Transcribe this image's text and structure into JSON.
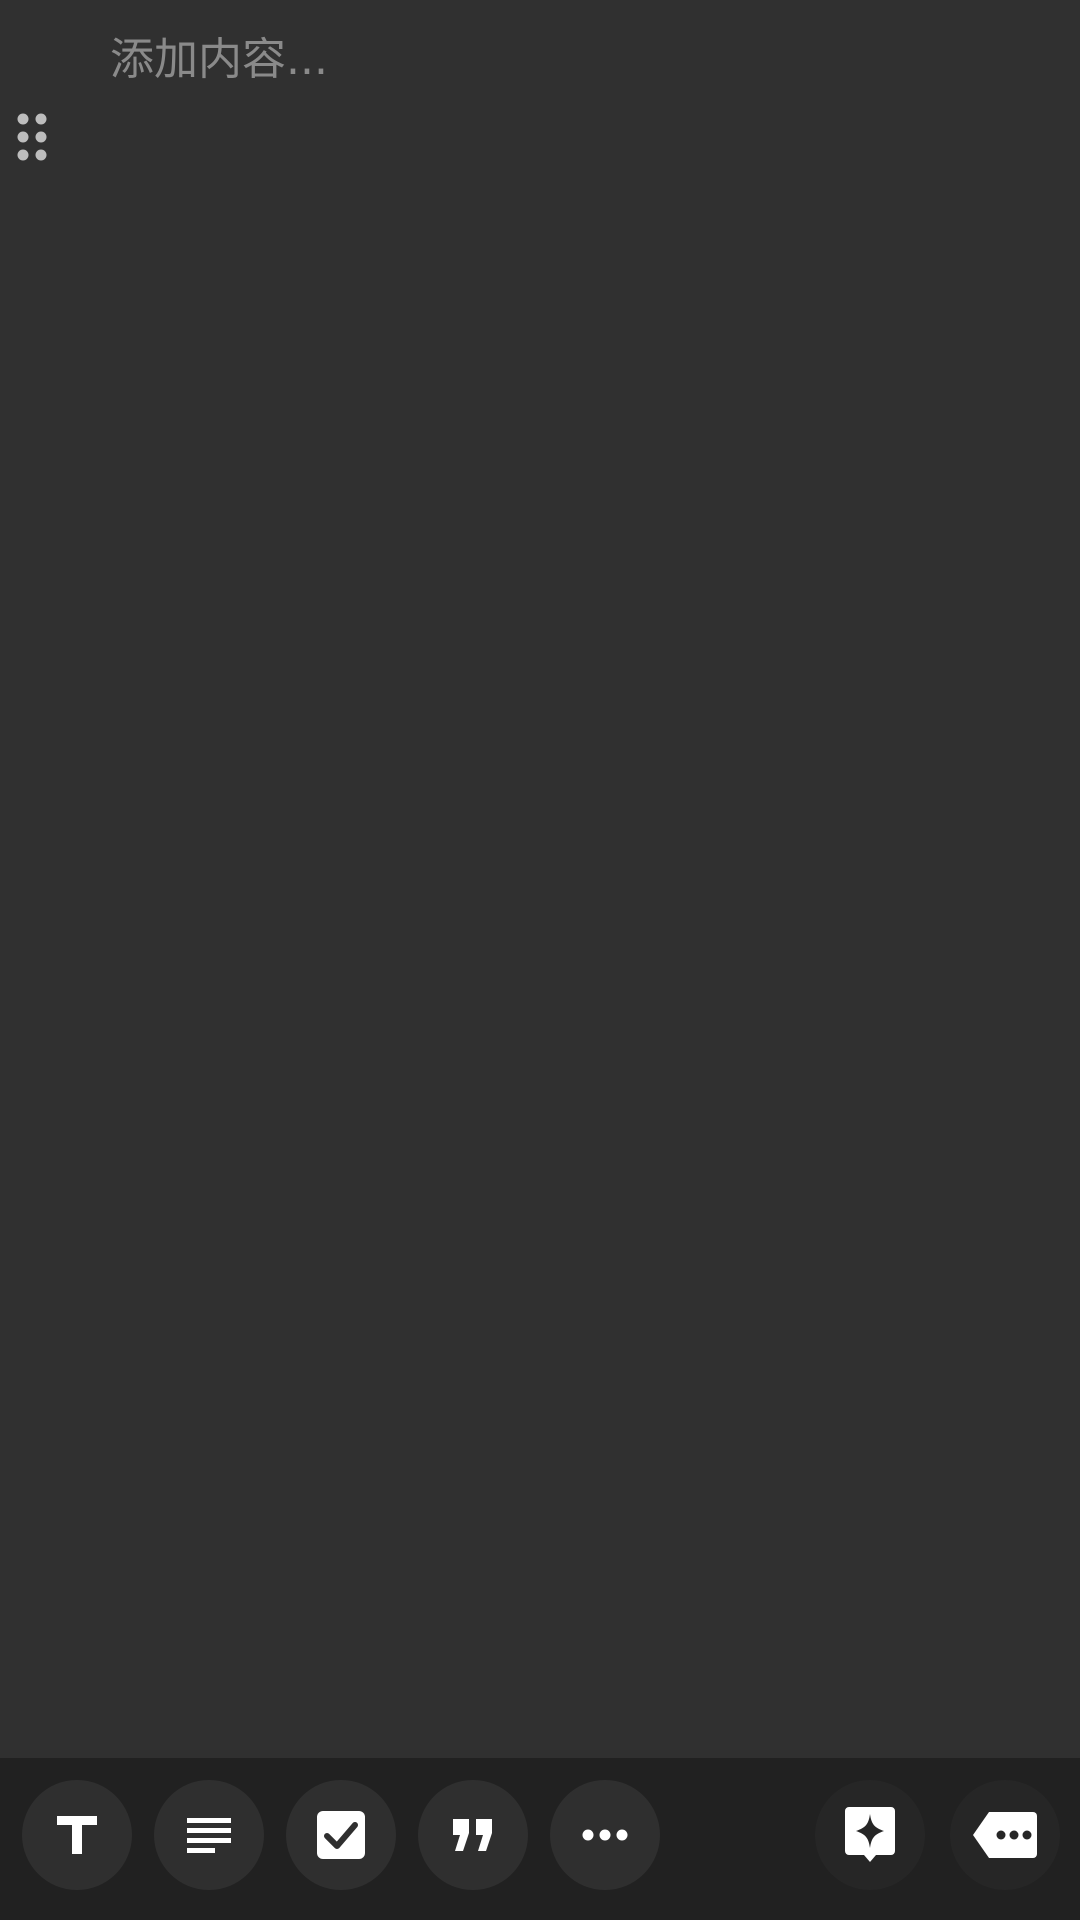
{
  "editor": {
    "placeholder": "添加内容..."
  },
  "toolbar": {
    "buttons": [
      {
        "icon": "title-t-icon",
        "action": "title"
      },
      {
        "icon": "paragraph-lines-icon",
        "action": "paragraph"
      },
      {
        "icon": "checkbox-icon",
        "action": "checklist"
      },
      {
        "icon": "quote-icon",
        "action": "quote"
      },
      {
        "icon": "more-dots-icon",
        "action": "more"
      },
      {
        "icon": "ai-sparkle-icon",
        "action": "ai-assist"
      },
      {
        "icon": "keyboard-hide-icon",
        "action": "hide-keyboard"
      }
    ]
  },
  "colors": {
    "background": "#303030",
    "toolbar": "#212121",
    "button": "#2f2f2f",
    "placeholder_text": "#8a8a8a",
    "icon": "#ffffff"
  }
}
